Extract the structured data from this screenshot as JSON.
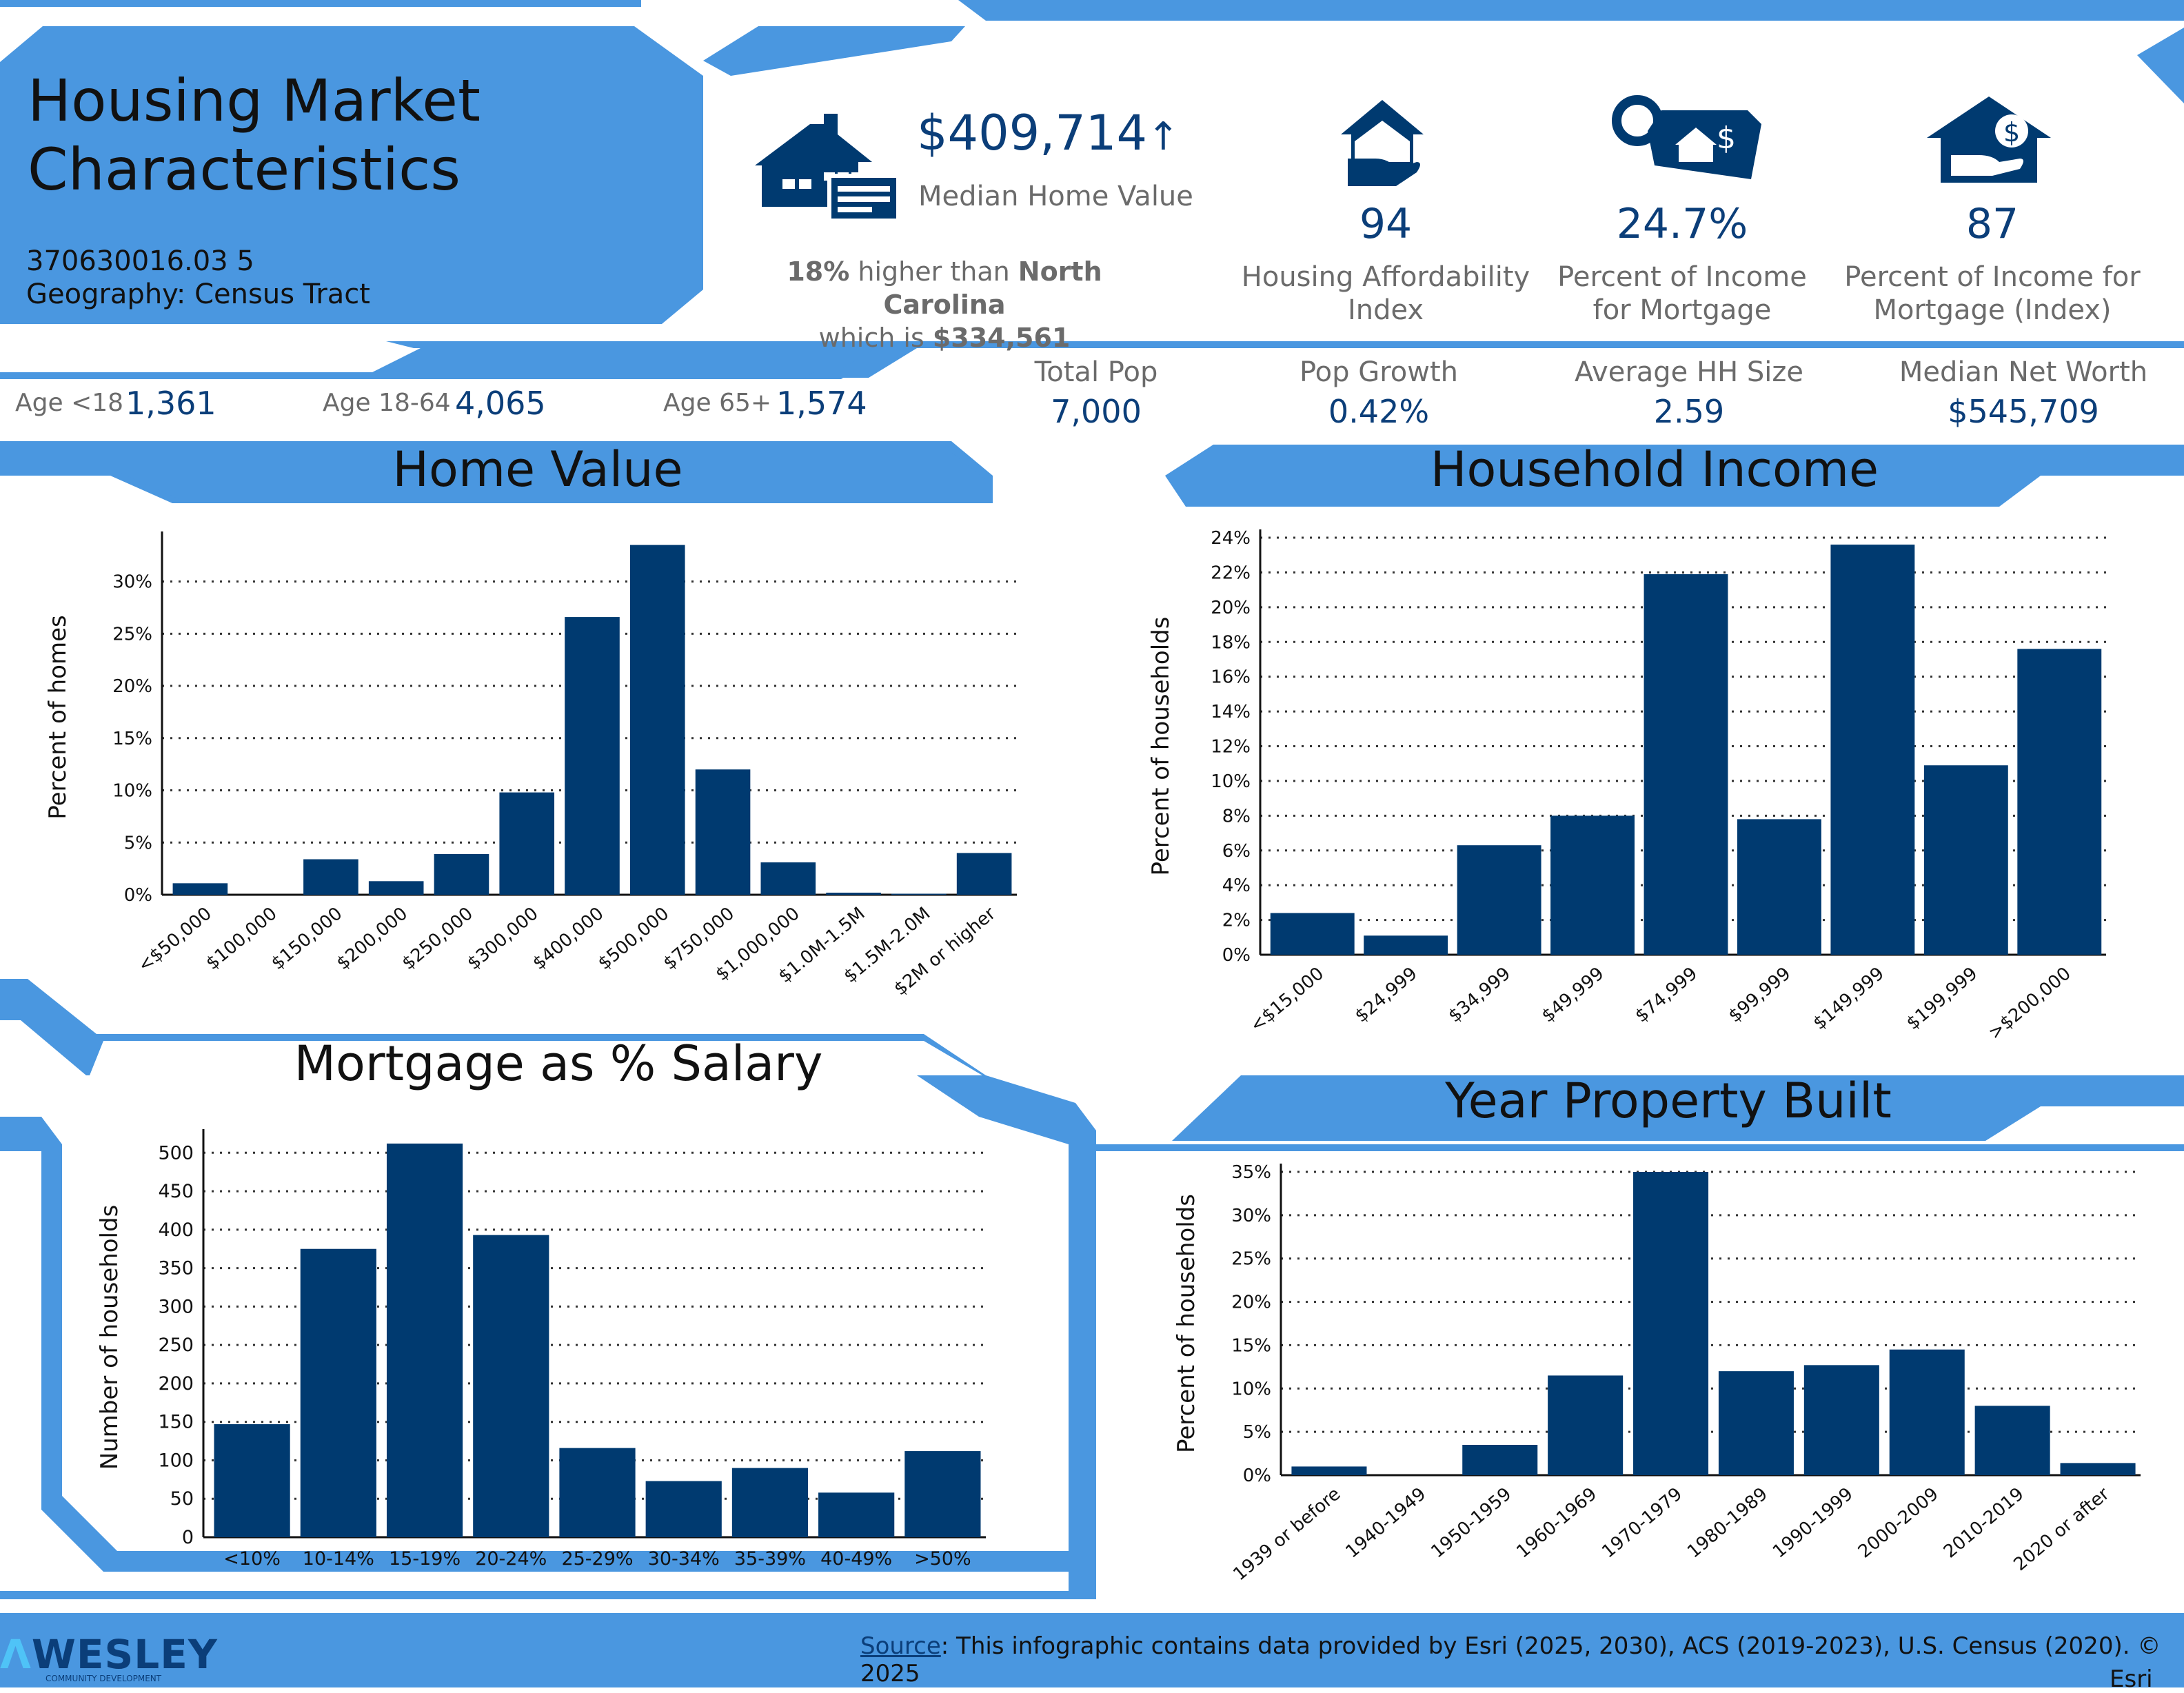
{
  "header": {
    "title_line1": "Housing Market",
    "title_line2": "Characteristics",
    "tract_id": "370630016.03 5",
    "geography": "Geography: Census Tract"
  },
  "median_home": {
    "value": "$409,714",
    "arrow": "↑",
    "label": "Median Home Value",
    "compare_pct": "18%",
    "compare_text": "higher than",
    "compare_state": "North Carolina",
    "which_is": "which is",
    "state_value": "$334,561"
  },
  "metrics": [
    {
      "value": "94",
      "label_line1": "Housing Affordability",
      "label_line2": "Index",
      "icon": "house-hand-icon"
    },
    {
      "value": "24.7%",
      "label_line1": "Percent of Income",
      "label_line2": "for Mortgage",
      "icon": "price-tag-icon"
    },
    {
      "value": "87",
      "label_line1": "Percent of Income for",
      "label_line2": "Mortgage (Index)",
      "icon": "house-dollar-hand-icon"
    }
  ],
  "age": [
    {
      "label": "Age <18",
      "value": "1,361"
    },
    {
      "label": "Age 18-64",
      "value": "4,065"
    },
    {
      "label": "Age 65+",
      "value": "1,574"
    }
  ],
  "pop_stats": [
    {
      "label": "Total Pop",
      "value": "7,000"
    },
    {
      "label": "Pop Growth",
      "value": "0.42%"
    },
    {
      "label": "Average HH Size",
      "value": "2.59"
    },
    {
      "label": "Median Net Worth",
      "value": "$545,709"
    }
  ],
  "footer": {
    "logo_text": "WESLEY",
    "logo_sub": "COMMUNITY DEVELOPMENT",
    "source_link": "Source",
    "source_text": ": This infographic contains data provided by Esri (2025, 2030), ACS (2019-2023), U.S. Census (2020). © 2025",
    "source_text2": "Esri"
  },
  "colors": {
    "navy": "#003a70",
    "accent": "#4a97e0",
    "text_grey": "#6b6b6b"
  },
  "chart_data": [
    {
      "id": "home_value",
      "type": "bar",
      "title": "Home Value",
      "xlabel": "",
      "ylabel": "Percent of homes",
      "categories": [
        "<$50,000",
        "$100,000",
        "$150,000",
        "$200,000",
        "$250,000",
        "$300,000",
        "$400,000",
        "$500,000",
        "$750,000",
        "$1,000,000",
        "$1.0M-1.5M",
        "$1.5M-2.0M",
        "$2M or higher"
      ],
      "values": [
        1.1,
        0.0,
        3.4,
        1.3,
        3.9,
        9.8,
        26.6,
        33.5,
        12.0,
        3.1,
        0.2,
        0.1,
        4.0
      ],
      "yticks": [
        0,
        5,
        10,
        15,
        20,
        25,
        30
      ],
      "ylim": [
        0,
        34
      ],
      "y_suffix": "%",
      "grid": true
    },
    {
      "id": "household_income",
      "type": "bar",
      "title": "Household Income",
      "xlabel": "",
      "ylabel": "Percent of households",
      "categories": [
        "<$15,000",
        "$24,999",
        "$34,999",
        "$49,999",
        "$74,999",
        "$99,999",
        "$149,999",
        "$199,999",
        ">$200,000"
      ],
      "values": [
        2.4,
        1.1,
        6.3,
        8.0,
        21.9,
        7.8,
        23.6,
        10.9,
        17.6
      ],
      "yticks": [
        0,
        2,
        4,
        6,
        8,
        10,
        12,
        14,
        16,
        18,
        20,
        22,
        24
      ],
      "ylim": [
        0,
        24
      ],
      "y_suffix": "%",
      "grid": true
    },
    {
      "id": "mortgage_salary",
      "type": "bar",
      "title": "Mortgage as % Salary",
      "xlabel": "",
      "ylabel": "Number of households",
      "categories": [
        "<10%",
        "10-14%",
        "15-19%",
        "20-24%",
        "25-29%",
        "30-34%",
        "35-39%",
        "40-49%",
        ">50%"
      ],
      "values": [
        147,
        375,
        512,
        393,
        116,
        73,
        90,
        58,
        112
      ],
      "yticks": [
        0,
        50,
        100,
        150,
        200,
        250,
        300,
        350,
        400,
        450,
        500
      ],
      "ylim": [
        0,
        520
      ],
      "y_suffix": "",
      "grid": true
    },
    {
      "id": "year_built",
      "type": "bar",
      "title": "Year Property Built",
      "xlabel": "",
      "ylabel": "Percent of households",
      "categories": [
        "1939 or before",
        "1940-1949",
        "1950-1959",
        "1960-1969",
        "1970-1979",
        "1980-1989",
        "1990-1999",
        "2000-2009",
        "2010-2019",
        "2020 or after"
      ],
      "values": [
        1.0,
        0.0,
        3.5,
        11.5,
        35.0,
        12.0,
        12.7,
        14.5,
        8.0,
        1.4
      ],
      "yticks": [
        0,
        5,
        10,
        15,
        20,
        25,
        30,
        35
      ],
      "ylim": [
        0,
        35
      ],
      "y_suffix": "%",
      "grid": true
    }
  ]
}
